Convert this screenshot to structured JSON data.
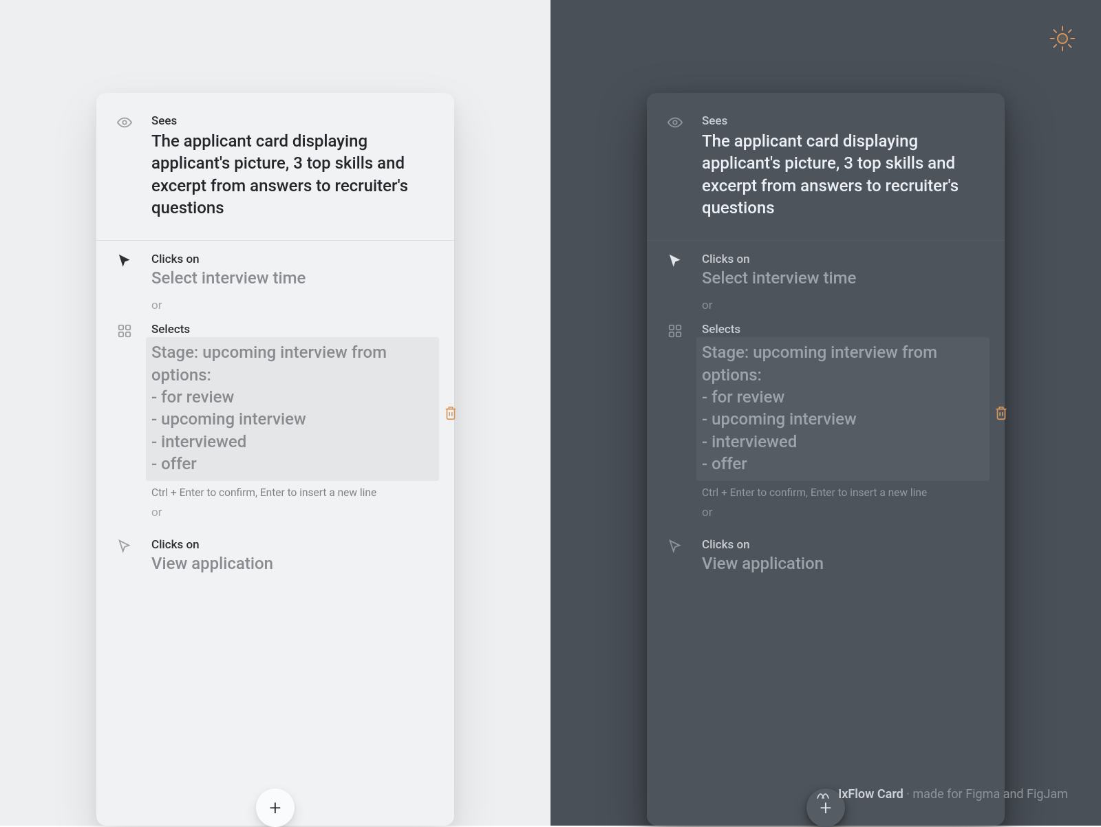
{
  "sees": {
    "label": "Sees",
    "text": "The applicant card displaying applicant's picture, 3 top skills and excerpt from answers to recruiter's questions"
  },
  "clicks1": {
    "label": "Clicks on",
    "text": "Select interview time"
  },
  "or": "or",
  "selects": {
    "label": "Selects",
    "text": "Stage: upcoming interview from options:\n- for review\n- upcoming interview\n- interviewed\n- offer",
    "hint": "Ctrl + Enter to confirm, Enter to insert a new line"
  },
  "clicks2": {
    "label": "Clicks on",
    "text": "View application"
  },
  "footer": {
    "brand": "IxFlow Card",
    "sub": " · made for Figma and FigJam"
  },
  "colors": {
    "accent": "#d8975f"
  }
}
